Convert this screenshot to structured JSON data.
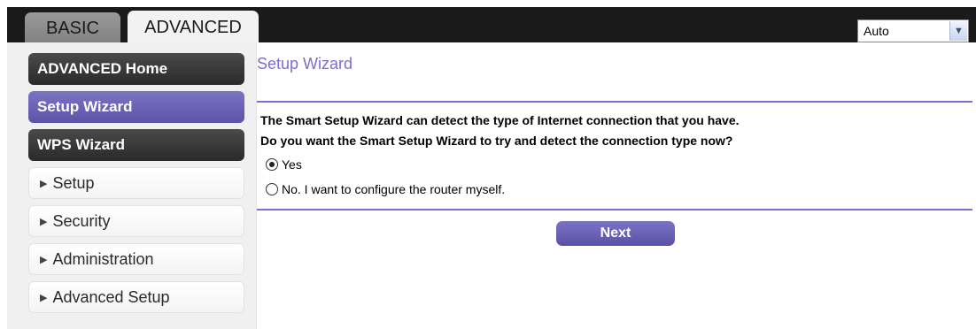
{
  "tabs": {
    "basic": "BASIC",
    "advanced": "ADVANCED"
  },
  "language_select": {
    "value": "Auto",
    "arrow_icon": "chevron-down-icon"
  },
  "sidebar": {
    "items": [
      {
        "label": "ADVANCED Home",
        "style": "dark"
      },
      {
        "label": "Setup Wizard",
        "style": "active"
      },
      {
        "label": "WPS Wizard",
        "style": "dark"
      },
      {
        "label": "Setup",
        "style": "collapsible"
      },
      {
        "label": "Security",
        "style": "collapsible"
      },
      {
        "label": "Administration",
        "style": "collapsible"
      },
      {
        "label": "Advanced Setup",
        "style": "collapsible"
      }
    ],
    "collapse_glyph": "▶"
  },
  "main": {
    "title": "Setup Wizard",
    "line1": "The Smart Setup Wizard can detect the type of Internet connection that you have.",
    "line2": "Do you want the Smart Setup Wizard to try and detect the connection type now?",
    "options": [
      {
        "label": "Yes",
        "selected": true
      },
      {
        "label": "No. I want to configure the router myself.",
        "selected": false
      }
    ],
    "next_label": "Next"
  },
  "colors": {
    "accent": "#7a6fd0",
    "active_nav": "#6a62b6",
    "topbar": "#1a1a1a"
  }
}
